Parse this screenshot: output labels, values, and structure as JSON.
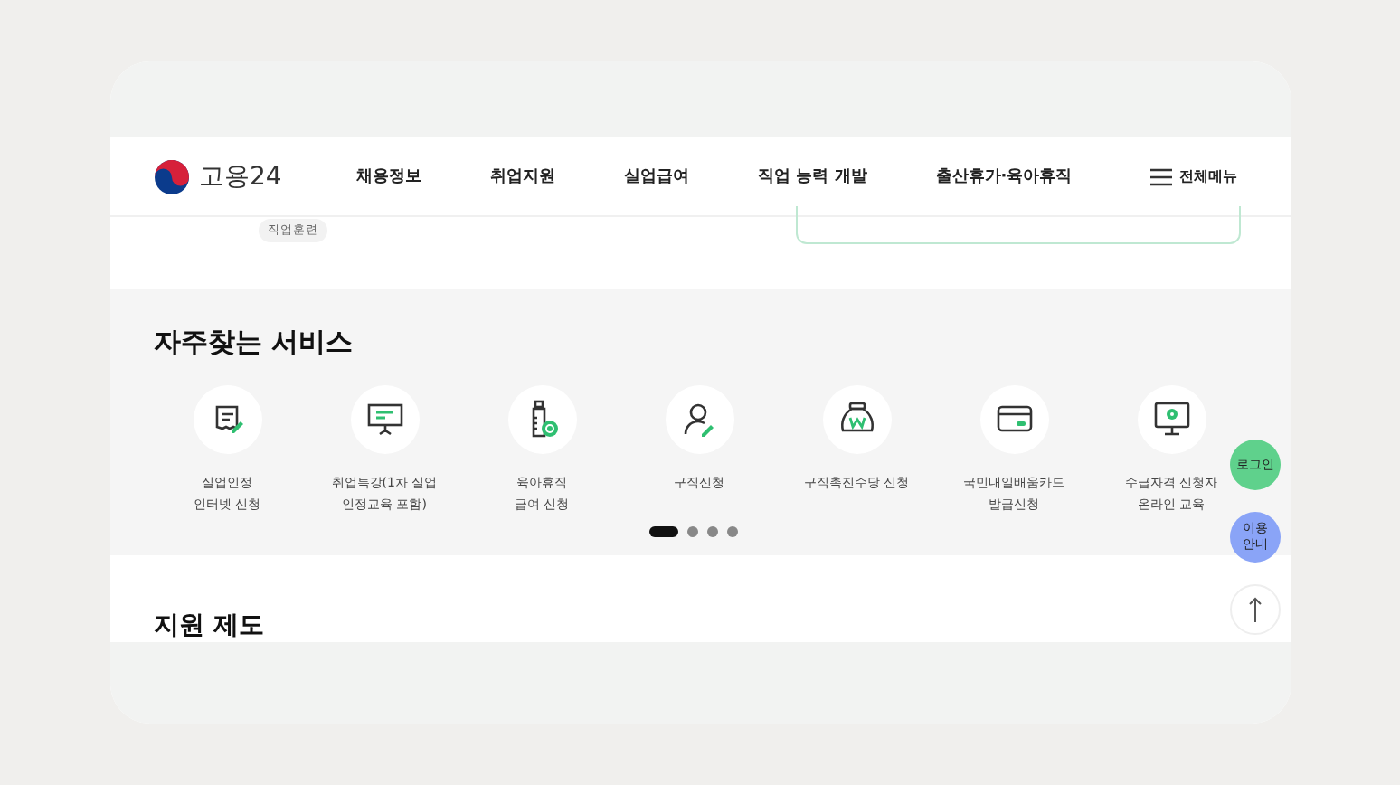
{
  "header": {
    "logo_text": "고용24",
    "nav": [
      "채용정보",
      "취업지원",
      "실업급여",
      "직업 능력 개발",
      "출산휴가·육아휴직"
    ],
    "menu_label": "전체메뉴"
  },
  "strip": {
    "tag": "직업훈련"
  },
  "services": {
    "title": "자주찾는 서비스",
    "items": [
      {
        "label": "실업인정\n인터넷 신청"
      },
      {
        "label": "취업특강(1차 실업\n인정교육 포함)"
      },
      {
        "label": "육아휴직\n급여 신청"
      },
      {
        "label": "구직신청"
      },
      {
        "label": "구직촉진수당 신청"
      },
      {
        "label": "국민내일배움카드\n발급신청"
      },
      {
        "label": "수급자격 신청자\n온라인 교육"
      }
    ],
    "pages": [
      {
        "selected": true
      },
      {
        "selected": false
      },
      {
        "selected": false
      },
      {
        "selected": false
      }
    ]
  },
  "next_section": {
    "title": "지원 제도"
  },
  "floating": [
    {
      "kind": "login",
      "label": "로그인"
    },
    {
      "kind": "guide",
      "label": "이용\n안내"
    },
    {
      "kind": "top"
    }
  ]
}
